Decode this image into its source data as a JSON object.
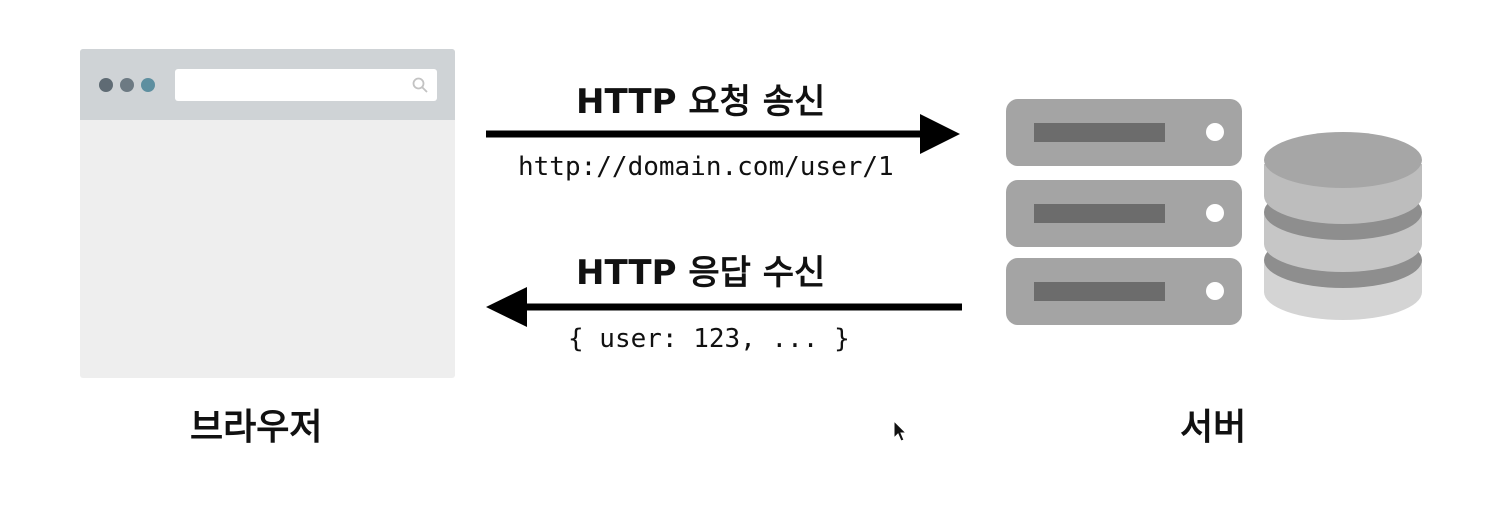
{
  "request": {
    "title": "HTTP 요청 송신",
    "url": "http://domain.com/user/1"
  },
  "response": {
    "title": "HTTP 응답 수신",
    "body": "{ user: 123,  ... }"
  },
  "browser": {
    "label": "브라우저"
  },
  "server": {
    "label": "서버"
  },
  "icons": {
    "browser": "browser-window-icon",
    "search": "search-icon",
    "server": "server-rack-icon",
    "database": "database-icon",
    "cursor": "mouse-cursor-icon"
  },
  "colors": {
    "browser_body": "#eeeeee",
    "browser_bar": "#cfd3d6",
    "server_unit": "#a4a4a4",
    "server_slot": "#6c6c6c",
    "database_light": "#bdbdbd",
    "database_dark": "#8e8e8e",
    "arrow": "#000000"
  }
}
